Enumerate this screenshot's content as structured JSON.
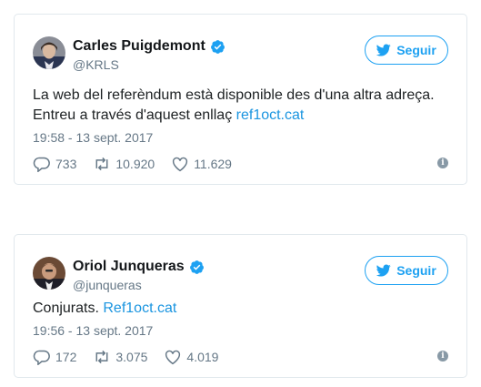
{
  "colors": {
    "accent": "#1da1f2",
    "link": "#1b95e0",
    "muted": "#657786",
    "border": "#e1e8ed"
  },
  "tweets": [
    {
      "name": "Carles Puigdemont",
      "handle": "@KRLS",
      "follow_label": "Seguir",
      "text_line1": "La web del referèndum està disponible des d'una altra adreça.",
      "text_line2": "Entreu a través d'aquest enllaç ",
      "link": "ref1oct.cat",
      "timestamp": "19:58 - 13 sept. 2017",
      "replies": "733",
      "retweets": "10.920",
      "likes": "11.629"
    },
    {
      "name": "Oriol Junqueras",
      "handle": "@junqueras",
      "follow_label": "Seguir",
      "text": "Conjurats. ",
      "link": "Ref1oct.cat",
      "timestamp": "19:56 - 13 sept. 2017",
      "replies": "172",
      "retweets": "3.075",
      "likes": "4.019"
    }
  ]
}
